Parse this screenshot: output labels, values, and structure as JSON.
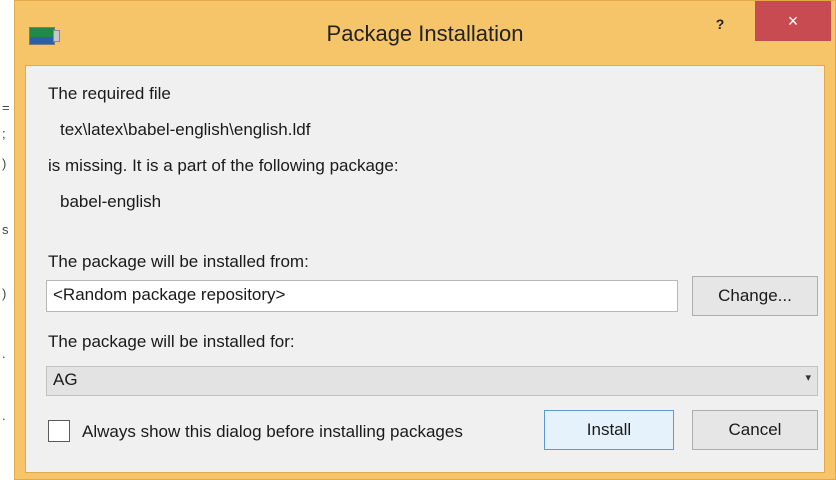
{
  "window": {
    "title": "Package Installation",
    "help_label": "?",
    "close_label": "×"
  },
  "background": {
    "glyphs": [
      "=",
      ";",
      ")",
      "s",
      ")",
      ".",
      "."
    ]
  },
  "dialog": {
    "intro": "The required file",
    "file_path": "tex\\latex\\babel-english\\english.ldf",
    "missing_text": "is missing. It is a part of the following package:",
    "package_name": "babel-english",
    "source_label": "The package will be installed from:",
    "source_value": "<Random package repository>",
    "change_button": "Change...",
    "target_label": "The package will be installed for:",
    "target_value": "AG",
    "checkbox_label": "Always show this dialog before installing packages",
    "checkbox_checked": false,
    "install_button": "Install",
    "cancel_button": "Cancel"
  },
  "colors": {
    "frame": "#f6c56a",
    "close_button": "#c74b50",
    "client_bg": "#f0f0f0",
    "default_button_border": "#5b9bd5"
  }
}
